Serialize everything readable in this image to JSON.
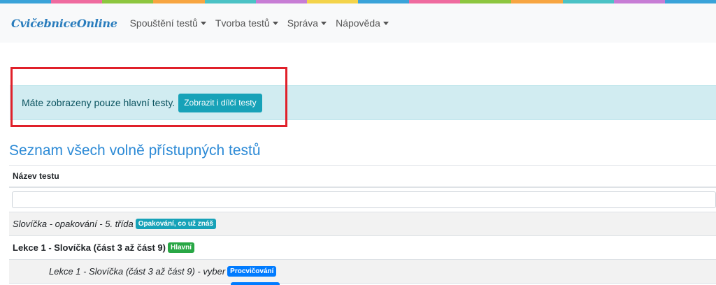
{
  "stripe_colors": [
    "#3aa3d9",
    "#ef6b9f",
    "#8dc63f",
    "#f7a541",
    "#4bc2c5",
    "#c77dd5",
    "#f3d34a",
    "#3aa3d9",
    "#ef6b9f",
    "#8dc63f",
    "#f7a541",
    "#4bc2c5",
    "#c77dd5",
    "#3aa3d9"
  ],
  "navbar": {
    "brand": "CvičebniceOnline",
    "items": [
      {
        "label": "Spouštění testů"
      },
      {
        "label": "Tvorba testů"
      },
      {
        "label": "Správa"
      },
      {
        "label": "Nápověda"
      }
    ]
  },
  "alert": {
    "text": "Máte zobrazeny pouze hlavní testy.",
    "button": "Zobrazit i dílčí testy"
  },
  "page_title": "Seznam všech volně přístupných testů",
  "table": {
    "header": "Název testu",
    "filter_value": "",
    "rows": [
      {
        "text": "Slovíčka - opakování - 5. třída",
        "badge": "Opakování, co už znáš"
      },
      {
        "text": "Lekce 1 - Slovíčka (část 3 až část 9)",
        "badge": "Hlavní"
      },
      {
        "text": "Lekce 1 - Slovíčka (část 3 až část 9) - vyber",
        "badge": "Procvičování"
      }
    ]
  }
}
